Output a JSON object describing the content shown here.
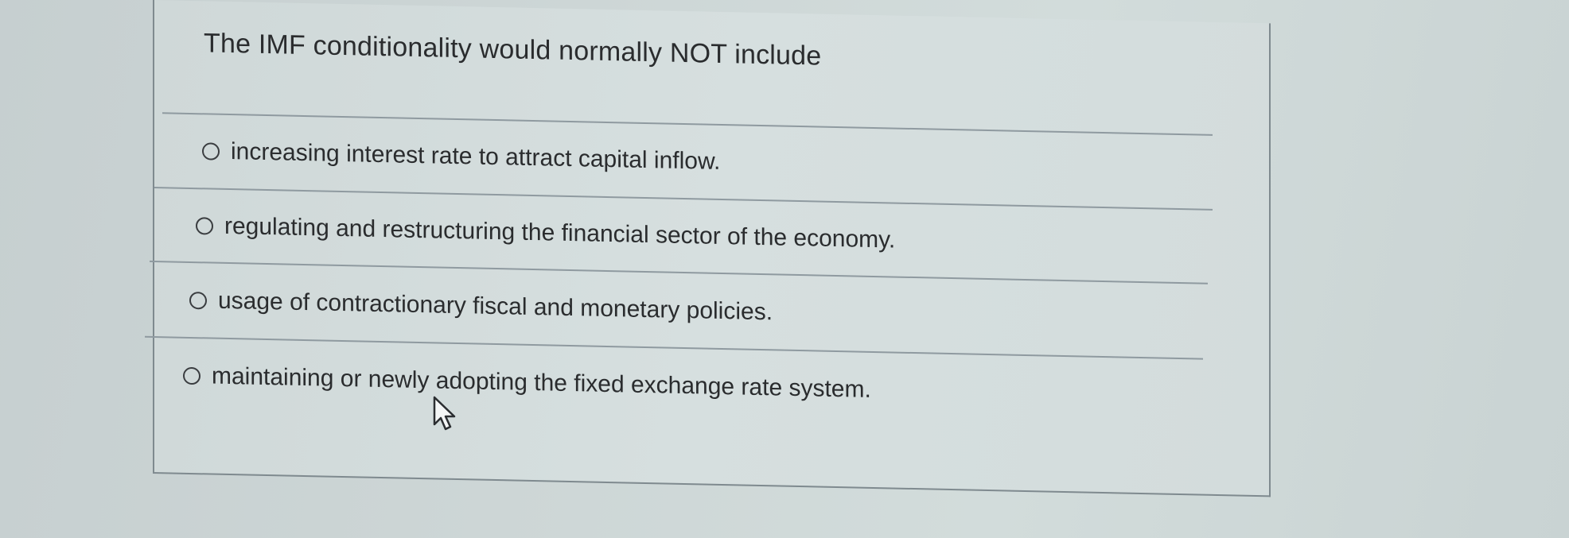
{
  "question": {
    "title": "The IMF conditionality would normally NOT include"
  },
  "options": [
    {
      "label": "increasing interest rate to attract capital inflow.",
      "selected": false
    },
    {
      "label": "regulating and restructuring the financial sector of the economy.",
      "selected": false
    },
    {
      "label": "usage of contractionary fiscal and monetary policies.",
      "selected": false
    },
    {
      "label": "maintaining or newly adopting the fixed exchange rate system.",
      "selected": false
    }
  ],
  "colors": {
    "background": "#cdd6d6",
    "text": "#2a2c2e",
    "divider": "#8f9aa0",
    "border": "#7f8a8f"
  },
  "icons": {
    "cursor": "mouse-pointer-icon",
    "radio": "radio-unselected-icon"
  }
}
